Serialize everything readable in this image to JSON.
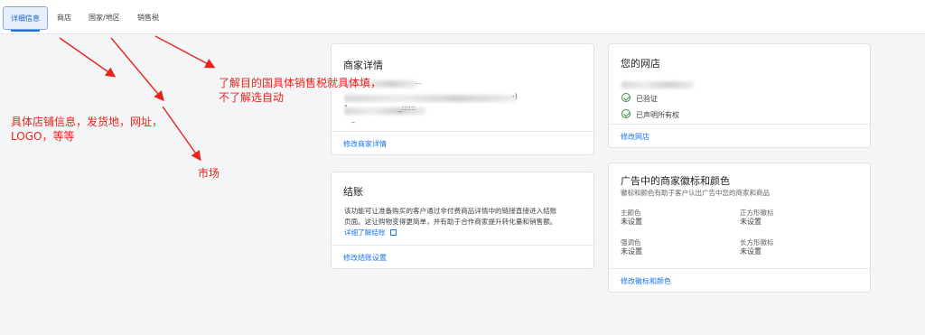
{
  "tabs": [
    {
      "label": "详细信息",
      "active": true
    },
    {
      "label": "商店"
    },
    {
      "label": "国家/地区"
    },
    {
      "label": "销售税"
    }
  ],
  "merchant_card": {
    "title": "商家详情",
    "line_fragments": [
      "...",
      "-)",
      "\"",
      "_::::::",
      "_"
    ],
    "footer_link": "修改商家详情"
  },
  "checkout_card": {
    "title": "结账",
    "description_line1": "该功能可让准备购买的客户通过非付费商品详情中的链接直接进入结账",
    "description_line2": "页面。这让购物变得更简单，并有助于合作商家提升转化量和销售额。",
    "learn_more": "详细了解结账",
    "footer_link": "修改结账设置"
  },
  "store_card": {
    "title": "您的网店",
    "status_verified": "已验证",
    "status_claimed": "已声明所有权",
    "footer_link": "修改网店"
  },
  "brand_card": {
    "title": "广告中的商家徽标和颜色",
    "subtitle": "徽标和颜色有助于客户认出广告中您的商家和商品",
    "fields": [
      {
        "label": "主颜色",
        "value": "未设置"
      },
      {
        "label": "正方形徽标",
        "value": "未设置"
      },
      {
        "label": "强调色",
        "value": "未设置"
      },
      {
        "label": "长方形徽标",
        "value": "未设置"
      }
    ],
    "footer_link": "修改徽标和颜色"
  },
  "annotations": {
    "sales_tax_line1": "了解目的国具体销售税就具体填，",
    "sales_tax_line2": "不了解选自动",
    "store_line1": "具体店铺信息，发货地，网址，",
    "store_line2": "LOGO，等等",
    "market": "市场",
    "color": "#e8231b"
  }
}
